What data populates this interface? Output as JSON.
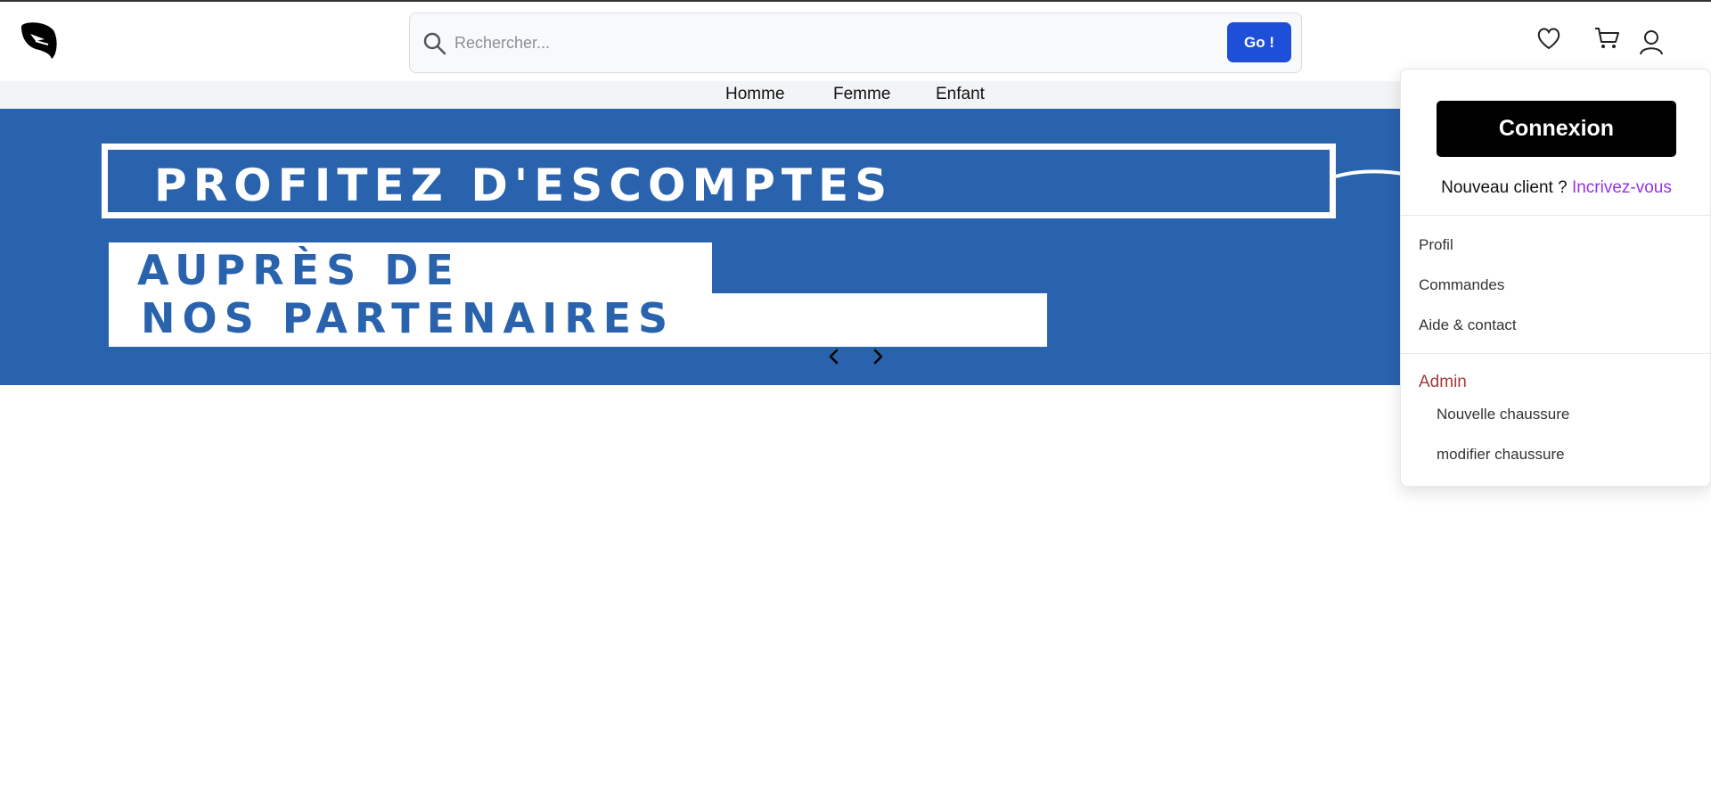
{
  "header": {
    "logo": "leaf-bird-logo",
    "search": {
      "placeholder": "Rechercher...",
      "value": "",
      "button_label": "Go !"
    },
    "icons": [
      "heart-icon",
      "cart-icon",
      "user-icon"
    ]
  },
  "nav": {
    "categories": [
      "Homme",
      "Femme",
      "Enfant"
    ]
  },
  "banner": {
    "line1": "PROFITEZ D'ESCOMPTES",
    "line2": "AUPRÈS DE",
    "line3": "NOS PARTENAIRES",
    "background": "#2963ad"
  },
  "account_menu": {
    "login_label": "Connexion",
    "new_client_text": "Nouveau client ?",
    "signup_link": "Incrivez-vous",
    "items": [
      "Profil",
      "Commandes",
      "Aide & contact"
    ],
    "admin_label": "Admin",
    "admin_items": [
      "Nouvelle chaussure",
      "modifier chaussure"
    ]
  },
  "colors": {
    "primary_button": "#1d4fd8",
    "link": "#9333ea",
    "admin": "#a33a3a"
  }
}
